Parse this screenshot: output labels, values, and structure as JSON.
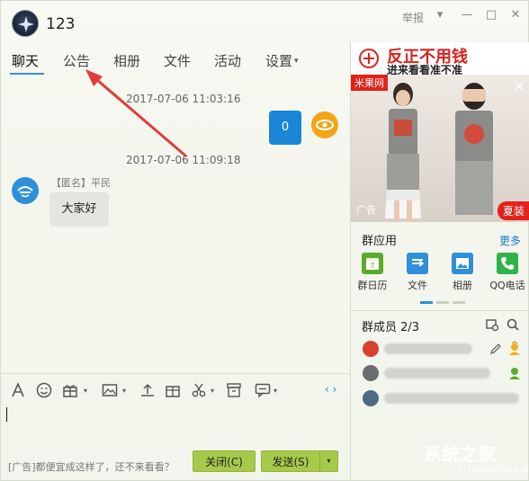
{
  "window": {
    "group_name": "123",
    "report_label": "举报",
    "controls": {
      "minimize": "—",
      "maximize": "□",
      "close": "✕"
    }
  },
  "tabs": [
    {
      "label": "聊天",
      "active": true
    },
    {
      "label": "公告",
      "active": false
    },
    {
      "label": "相册",
      "active": false
    },
    {
      "label": "文件",
      "active": false
    },
    {
      "label": "活动",
      "active": false
    },
    {
      "label": "设置",
      "active": false,
      "has_dropdown": true
    }
  ],
  "messages": [
    {
      "type": "timestamp",
      "text": "2017-07-06 11:03:16"
    },
    {
      "type": "self",
      "text": "0",
      "avatar_color": "#f2a516"
    },
    {
      "type": "timestamp",
      "text": "2017-07-06 11:09:18"
    },
    {
      "type": "other",
      "sender": "【匿名】平民",
      "text": "大家好",
      "avatar_color": "#2f8fd8"
    }
  ],
  "toolbar": {
    "icons": [
      "font-icon",
      "emoji-icon",
      "gift-icon",
      "image-icon",
      "upload-icon",
      "present-icon",
      "scissors-icon",
      "archive-icon",
      "chat-history-icon"
    ],
    "nav": "‹ ›"
  },
  "compose": {
    "ad_text": "[广告]都便宜成这样了，还不来看看？",
    "close_label": "关闭(C)",
    "send_label": "发送(S)"
  },
  "right_ad": {
    "banner_title": "反正不用钱",
    "banner_sub": "进来看看准不准",
    "brand": "米果网",
    "label": "广告",
    "tag": "夏装"
  },
  "apps": {
    "title": "群应用",
    "more": "更多",
    "items": [
      {
        "label": "群日历",
        "color": "#5aab2e",
        "icon": "calendar-icon"
      },
      {
        "label": "文件",
        "color": "#2f8fd8",
        "icon": "file-icon"
      },
      {
        "label": "相册",
        "color": "#2f8fd8",
        "icon": "album-icon"
      },
      {
        "label": "QQ电话",
        "color": "#2fb34a",
        "icon": "phone-icon"
      }
    ]
  },
  "members": {
    "title": "群成员 2/3",
    "items": [
      {
        "role": "owner"
      },
      {
        "role": "admin"
      },
      {
        "role": "member"
      }
    ]
  },
  "colors": {
    "accent": "#1a86d6",
    "send_button": "#a7c94a",
    "annotation": "#e23b3b"
  },
  "watermark": {
    "text": "系统之家",
    "url": "XITONGZHIJIA.NET"
  }
}
